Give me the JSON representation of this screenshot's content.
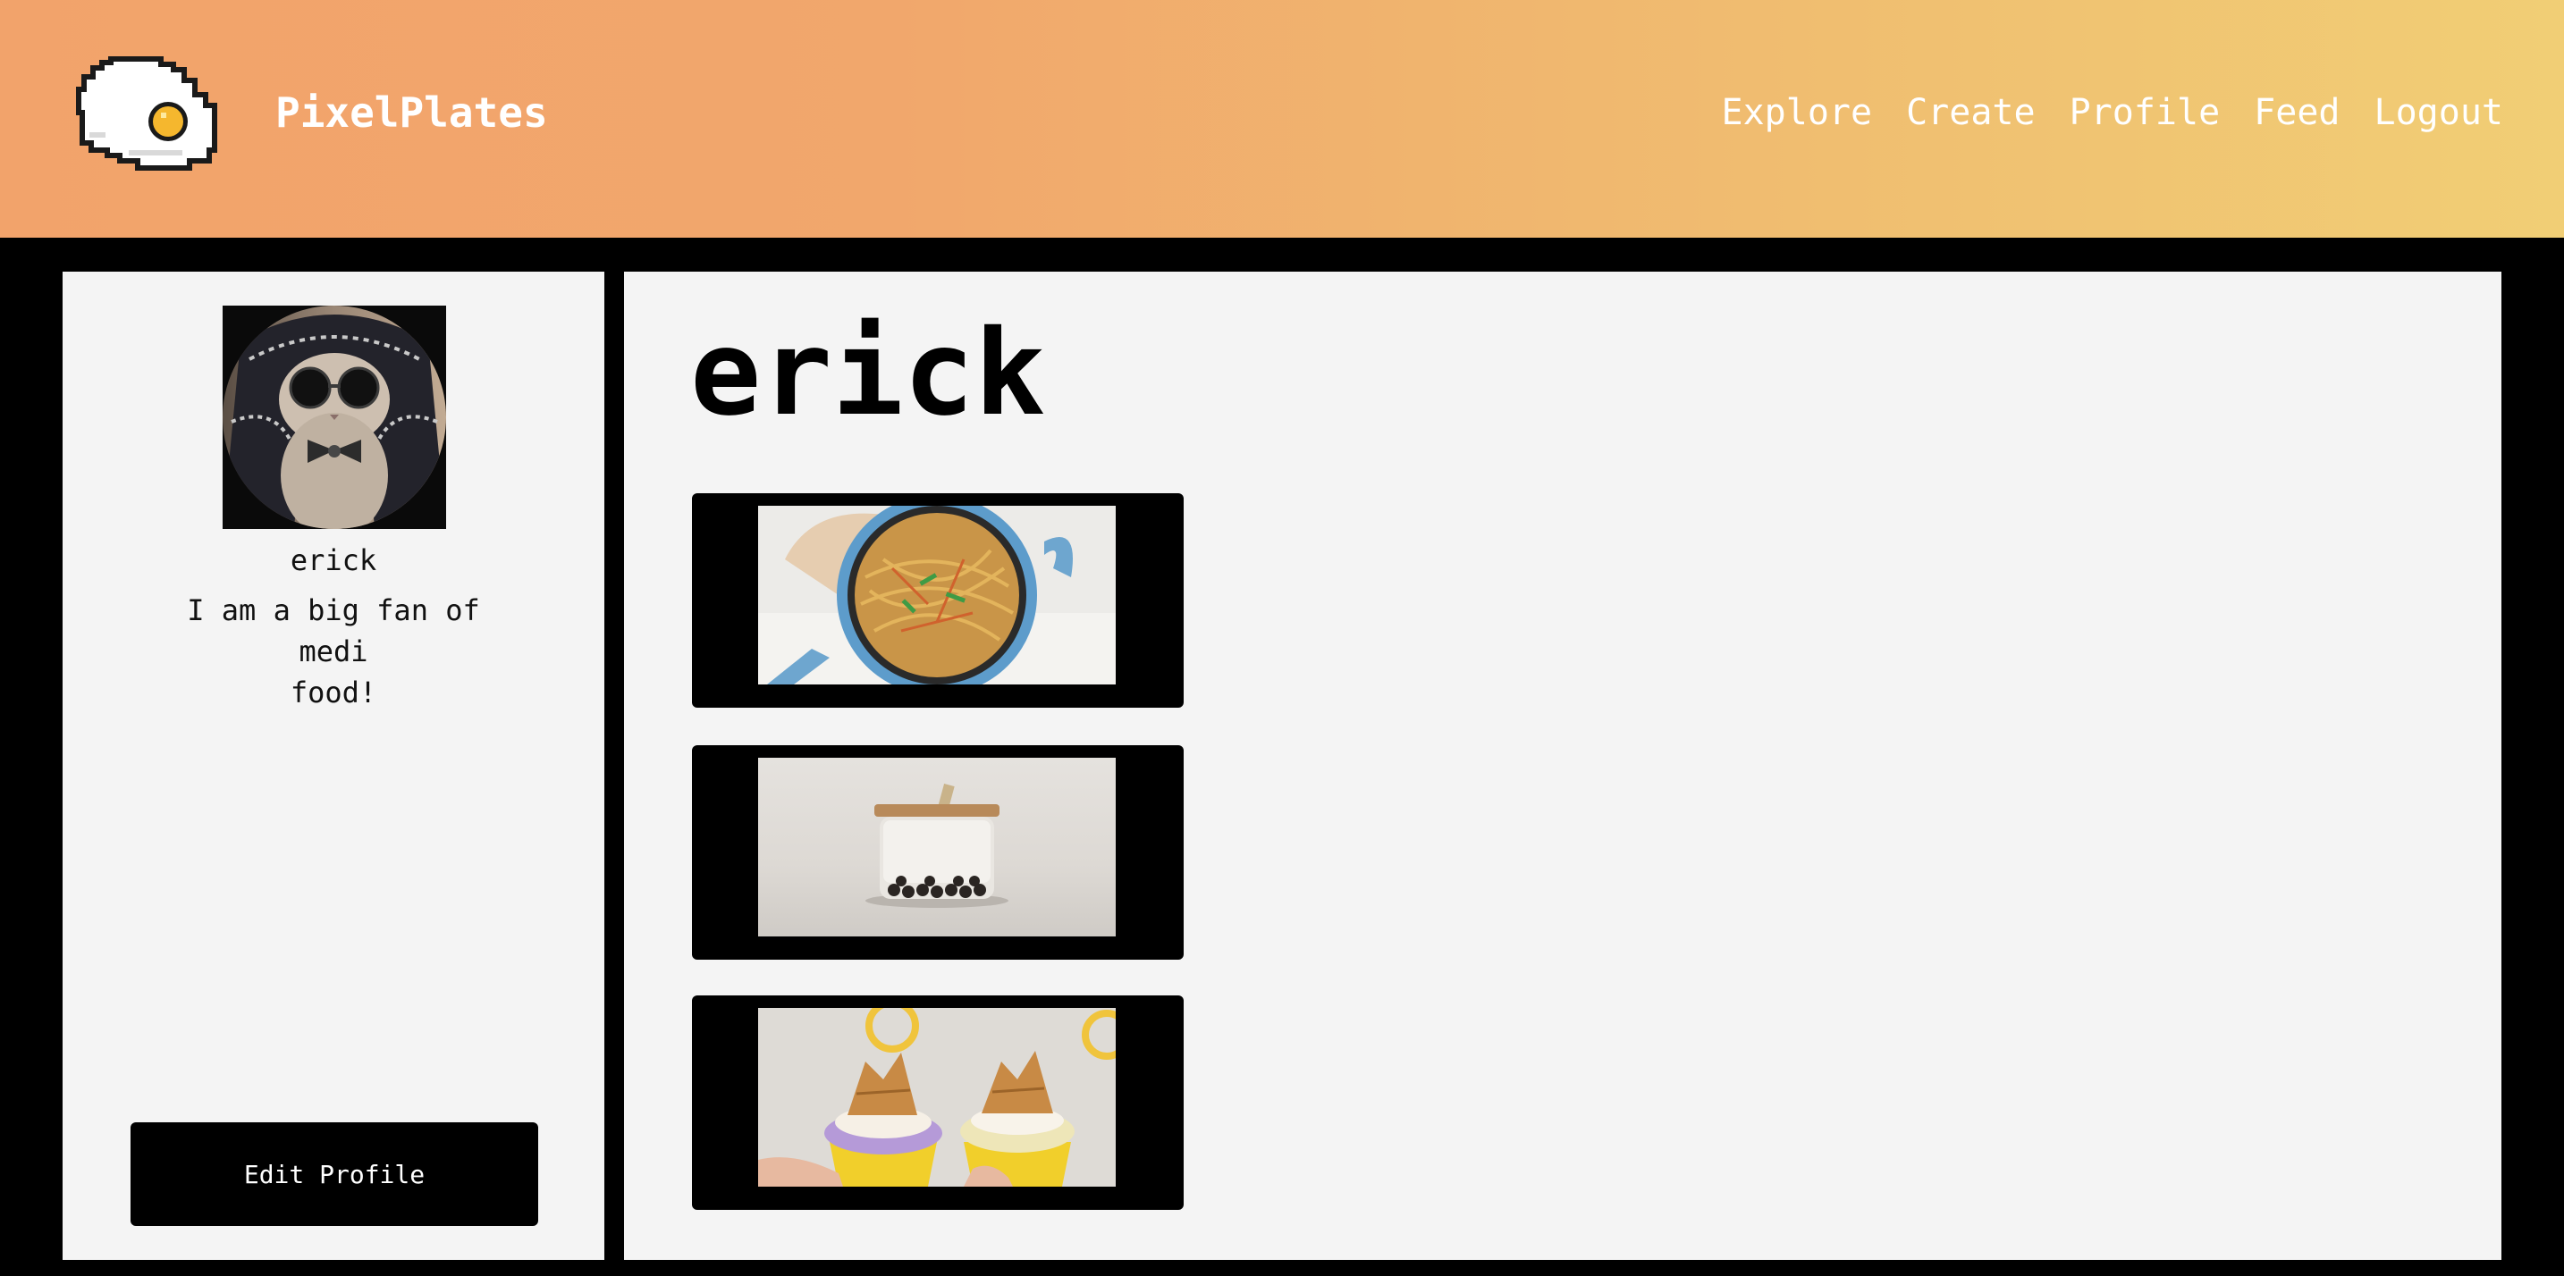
{
  "header": {
    "brand": "PixelPlates",
    "logo_icon": "fried-egg-pixel-icon",
    "nav": [
      {
        "label": "Explore"
      },
      {
        "label": "Create"
      },
      {
        "label": "Profile"
      },
      {
        "label": "Feed"
      },
      {
        "label": "Logout"
      }
    ]
  },
  "profile": {
    "avatar_icon": "cat-with-sunglasses-avatar",
    "username": "erick",
    "bio": "I am a big fan of medi\nfood!",
    "edit_button": "Edit Profile"
  },
  "main": {
    "title": "erick",
    "posts": [
      {
        "image": "noodles-in-pan"
      },
      {
        "image": "bubble-tea-jar"
      },
      {
        "image": "ice-cream-cups"
      }
    ]
  },
  "colors": {
    "header_gradient_start": "#f2a36b",
    "header_gradient_end": "#f1ce75",
    "panel_background": "#f4f4f4",
    "page_background": "#000000"
  }
}
